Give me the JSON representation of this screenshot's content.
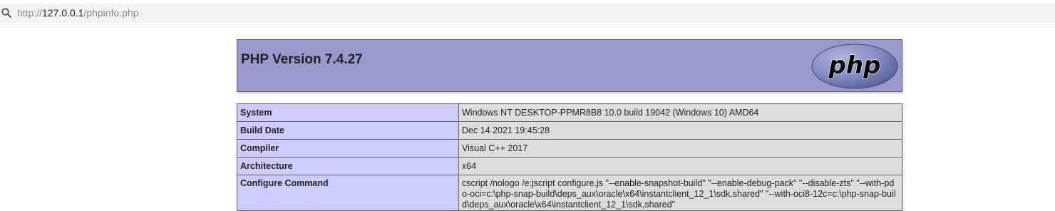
{
  "browser": {
    "url_scheme": "http://",
    "url_host": "127.0.0.1",
    "url_path": "/phpinfo.php"
  },
  "header": {
    "title": "PHP Version 7.4.27",
    "logo_text": "php"
  },
  "rows": [
    {
      "label": "System",
      "value": "Windows NT DESKTOP-PPMR8B8 10.0 build 19042 (Windows 10) AMD64"
    },
    {
      "label": "Build Date",
      "value": "Dec 14 2021 19:45:28"
    },
    {
      "label": "Compiler",
      "value": "Visual C++ 2017"
    },
    {
      "label": "Architecture",
      "value": "x64"
    },
    {
      "label": "Configure Command",
      "value": "cscript /nologo /e:jscript configure.js \"--enable-snapshot-build\" \"--enable-debug-pack\" \"--disable-zts\" \"--with-pdo-oci=c:\\php-snap-build\\deps_aux\\oracle\\x64\\instantclient_12_1\\sdk,shared\" \"--with-oci8-12c=c:\\php-snap-build\\deps_aux\\oracle\\x64\\instantclient_12_1\\sdk,shared\""
    }
  ],
  "colors": {
    "header_bg": "#9999cc",
    "label_bg": "#ccccff",
    "value_bg": "#dddddd"
  },
  "icons": {
    "search": "search-icon",
    "logo": "php-logo-icon"
  }
}
